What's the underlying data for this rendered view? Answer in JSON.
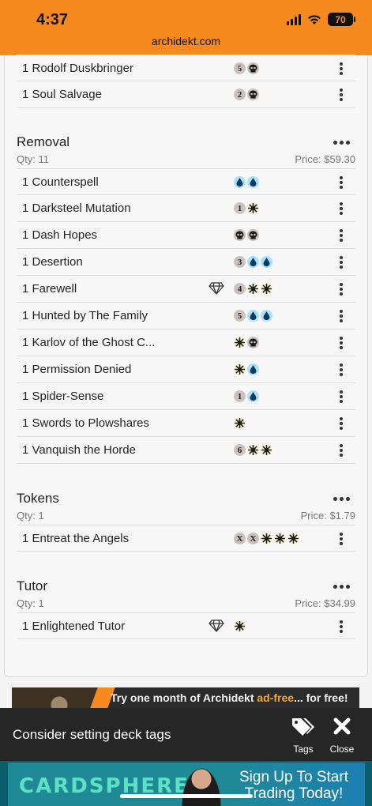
{
  "status_bar": {
    "time": "4:37",
    "battery": "70",
    "url": "archidekt.com"
  },
  "top_cards": [
    {
      "name": "1 Rodolf Duskbringer",
      "cost": [
        {
          "t": "num",
          "v": "5"
        },
        {
          "t": "b",
          "v": ""
        }
      ],
      "gem": false
    },
    {
      "name": "1 Soul Salvage",
      "cost": [
        {
          "t": "num",
          "v": "2"
        },
        {
          "t": "b",
          "v": ""
        }
      ],
      "gem": false
    }
  ],
  "categories": [
    {
      "title": "Removal",
      "qty": "Qty: 11",
      "price": "Price: $59.30",
      "cards": [
        {
          "name": "1 Counterspell",
          "cost": [
            {
              "t": "u",
              "v": ""
            },
            {
              "t": "u",
              "v": ""
            }
          ],
          "gem": false
        },
        {
          "name": "1 Darksteel Mutation",
          "cost": [
            {
              "t": "num",
              "v": "1"
            },
            {
              "t": "w",
              "v": ""
            }
          ],
          "gem": false
        },
        {
          "name": "1 Dash Hopes",
          "cost": [
            {
              "t": "b",
              "v": ""
            },
            {
              "t": "b",
              "v": ""
            }
          ],
          "gem": false
        },
        {
          "name": "1 Desertion",
          "cost": [
            {
              "t": "num",
              "v": "3"
            },
            {
              "t": "u",
              "v": ""
            },
            {
              "t": "u",
              "v": ""
            }
          ],
          "gem": false
        },
        {
          "name": "1 Farewell",
          "cost": [
            {
              "t": "num",
              "v": "4"
            },
            {
              "t": "w",
              "v": ""
            },
            {
              "t": "w",
              "v": ""
            }
          ],
          "gem": true
        },
        {
          "name": "1 Hunted by The Family",
          "cost": [
            {
              "t": "num",
              "v": "5"
            },
            {
              "t": "u",
              "v": ""
            },
            {
              "t": "u",
              "v": ""
            }
          ],
          "gem": false
        },
        {
          "name": "1 Karlov of the Ghost C...",
          "cost": [
            {
              "t": "w",
              "v": ""
            },
            {
              "t": "b",
              "v": ""
            }
          ],
          "gem": false
        },
        {
          "name": "1 Permission Denied",
          "cost": [
            {
              "t": "w",
              "v": ""
            },
            {
              "t": "u",
              "v": ""
            }
          ],
          "gem": false
        },
        {
          "name": "1 Spider-Sense",
          "cost": [
            {
              "t": "num",
              "v": "1"
            },
            {
              "t": "u",
              "v": ""
            }
          ],
          "gem": false
        },
        {
          "name": "1 Swords to Plowshares",
          "cost": [
            {
              "t": "w",
              "v": ""
            }
          ],
          "gem": false
        },
        {
          "name": "1 Vanquish the Horde",
          "cost": [
            {
              "t": "num",
              "v": "6"
            },
            {
              "t": "w",
              "v": ""
            },
            {
              "t": "w",
              "v": ""
            }
          ],
          "gem": false
        }
      ]
    },
    {
      "title": "Tokens",
      "qty": "Qty: 1",
      "price": "Price: $1.79",
      "cards": [
        {
          "name": "1 Entreat the Angels",
          "cost": [
            {
              "t": "num",
              "v": "X"
            },
            {
              "t": "num",
              "v": "X"
            },
            {
              "t": "w",
              "v": ""
            },
            {
              "t": "w",
              "v": ""
            },
            {
              "t": "w",
              "v": ""
            }
          ],
          "gem": false
        }
      ]
    },
    {
      "title": "Tutor",
      "qty": "Qty: 1",
      "price": "Price: $34.99",
      "cards": [
        {
          "name": "1 Enlightened Tutor",
          "cost": [
            {
              "t": "w",
              "v": ""
            }
          ],
          "gem": true
        }
      ]
    }
  ],
  "ad_banner": {
    "text_before": "Try one month of Archidekt ",
    "text_highlight": "ad-free",
    "text_after": "... for free!"
  },
  "toast": {
    "message": "Consider setting deck tags",
    "tags_label": "Tags",
    "close_label": "Close"
  },
  "bottom_ad": {
    "logo": "CARDSPHERE",
    "cta": "Sign Up To Start Trading Today!"
  },
  "colors": {
    "status_bar": "#f78a1e",
    "blue_mana": "#aae0fa",
    "black_mana": "#cbc2bf",
    "white_mana": "#f8f6d8"
  }
}
